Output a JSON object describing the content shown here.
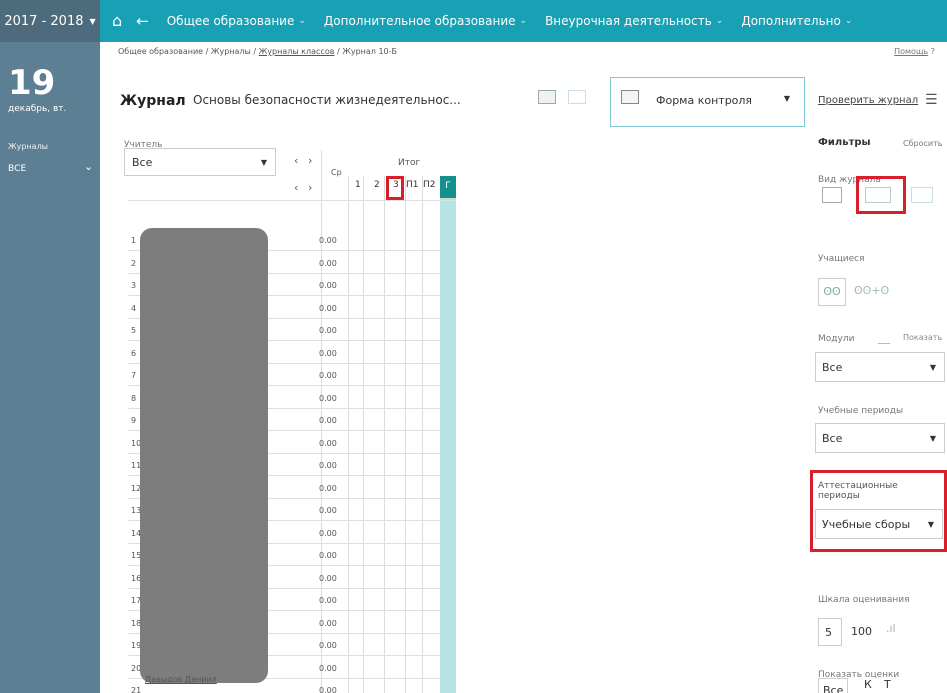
{
  "topbar": {
    "year": "2017 - 2018",
    "home_icon": "home-icon",
    "back_icon": "arrow-left-icon",
    "nav": [
      {
        "label": "Общее образование"
      },
      {
        "label": "Дополнительное образование"
      },
      {
        "label": "Внеурочная деятельность"
      },
      {
        "label": "Дополнительно"
      }
    ]
  },
  "sidebar": {
    "day": "19",
    "date": "декабрь, вт.",
    "journals_label": "Журналы",
    "all_label": "ВСЕ"
  },
  "breadcrumb": {
    "part1": "Общее образование / Журналы / ",
    "link": "Журналы классов",
    "part2": " / Журнал 10-Б"
  },
  "help": {
    "label": "Помощь",
    "icon": "?"
  },
  "header": {
    "title": "Журнал",
    "subject": "Основы безопасности жизнедеятельнос...",
    "control_form": "Форма контроля",
    "check_journal": "Проверить журнал"
  },
  "teacher": {
    "label": "Учитель",
    "value": "Все"
  },
  "grid": {
    "avg_header": "Ср",
    "total_header": "Итог",
    "columns": [
      "1",
      "2",
      "3",
      "П1",
      "П2",
      "Г"
    ],
    "rows": [
      {
        "n": "1",
        "avg": "0.00"
      },
      {
        "n": "2",
        "avg": "0.00"
      },
      {
        "n": "3",
        "avg": "0.00"
      },
      {
        "n": "4",
        "avg": "0.00"
      },
      {
        "n": "5",
        "avg": "0.00"
      },
      {
        "n": "6",
        "avg": "0.00"
      },
      {
        "n": "7",
        "avg": "0.00"
      },
      {
        "n": "8",
        "avg": "0.00"
      },
      {
        "n": "9",
        "avg": "0.00"
      },
      {
        "n": "10",
        "avg": "0.00"
      },
      {
        "n": "11",
        "avg": "0.00"
      },
      {
        "n": "12",
        "avg": "0.00"
      },
      {
        "n": "13",
        "avg": "0.00"
      },
      {
        "n": "14",
        "avg": "0.00"
      },
      {
        "n": "15",
        "avg": "0.00"
      },
      {
        "n": "16",
        "avg": "0.00"
      },
      {
        "n": "17",
        "avg": "0.00"
      },
      {
        "n": "18",
        "avg": "0.00"
      },
      {
        "n": "19",
        "avg": "0.00"
      },
      {
        "n": "20",
        "avg": "0.00"
      },
      {
        "n": "21",
        "avg": "0.00"
      }
    ],
    "last_student_name": "Давыдов Даниил"
  },
  "filters": {
    "title": "Фильтры",
    "reset": "Сбросить",
    "view_label": "Вид журнала",
    "students_label": "Учащиеся",
    "modules_label": "Модули",
    "modules_show": "Показать",
    "modules_value": "Все",
    "study_periods_label": "Учебные периоды",
    "study_periods_value": "Все",
    "attest_label": "Аттестационные периоды",
    "attest_value": "Учебные сборы",
    "scale_label": "Шкала оценивания",
    "scale_options": [
      "5",
      "100"
    ],
    "show_marks_label": "Показать оценки",
    "marks_options": [
      "Все",
      "К",
      "Т"
    ]
  },
  "colors": {
    "topbar": "#18a0b4",
    "sidebar": "#5d7f93",
    "highlight": "#d8202b",
    "teal": "#168f8f"
  }
}
